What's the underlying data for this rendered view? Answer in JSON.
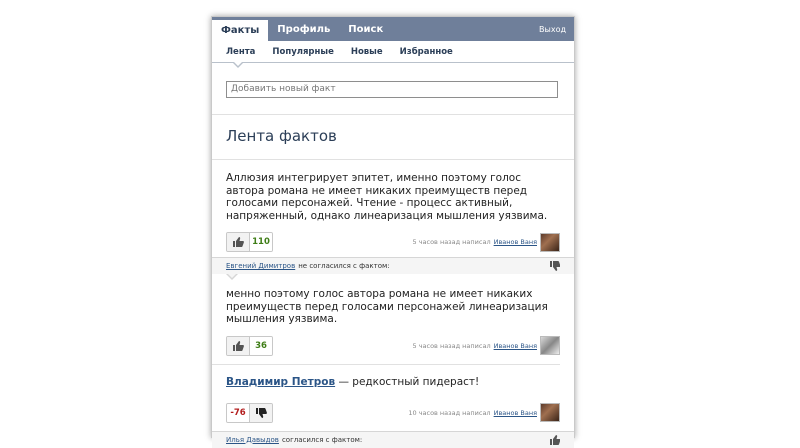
{
  "topnav": {
    "tabs": [
      "Факты",
      "Профиль",
      "Поиск"
    ],
    "logout": "Выход"
  },
  "subnav": {
    "tabs": [
      "Лента",
      "Популярные",
      "Новые",
      "Избранное"
    ]
  },
  "add_fact": {
    "placeholder": "Добавить новый факт"
  },
  "feed_title": "Лента фактов",
  "posts": [
    {
      "text": "Аллюзия интегрирует эпитет, именно поэтому голос автора романа не имеет никаких преимуществ перед голосами персонажей. Чтение - процесс активный, напряженный, однако линеаризация мышления уязвима.",
      "votes": "110",
      "meta": "5 часов назад написал",
      "author": "Иванов Ваня"
    },
    {
      "reply_user": "Евгений Димитров",
      "reply_text": "не согласился с фактом:",
      "text": "менно поэтому голос автора романа не имеет никаких преимуществ перед голосами персонажей линеаризация мышления уязвима.",
      "votes": "36",
      "meta": "5 часов назад написал",
      "author": "Иванов Ваня"
    },
    {
      "headline_link": "Владимир Петров",
      "headline_rest": " — редкостный пидераст!",
      "votes": "-76",
      "meta": "10 часов назад написал",
      "author": "Иванов Ваня"
    },
    {
      "reply_user": "Илья Давыдов",
      "reply_text": "согласился с фактом:"
    }
  ]
}
